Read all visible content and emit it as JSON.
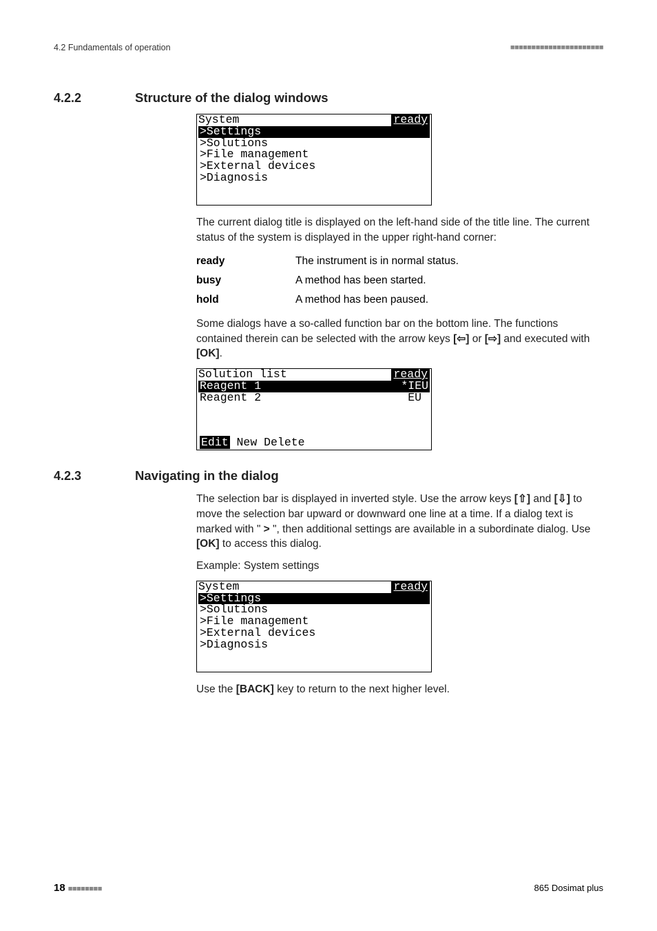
{
  "header": {
    "left": "4.2 Fundamentals of operation",
    "right": "■■■■■■■■■■■■■■■■■■■■■■"
  },
  "sec422": {
    "num": "4.2.2",
    "title": "Structure of the dialog windows",
    "lcd1": {
      "title_left": "System",
      "title_right": "ready",
      "rows": [
        {
          "text": ">Settings",
          "sel": true
        },
        {
          "text": ">Solutions",
          "sel": false
        },
        {
          "text": ">File management",
          "sel": false
        },
        {
          "text": ">External devices",
          "sel": false
        },
        {
          "text": ">Diagnosis",
          "sel": false
        }
      ]
    },
    "para1": "The current dialog title is displayed on the left-hand side of the title line. The current status of the system is displayed in the upper right-hand corner:",
    "defs": [
      {
        "term": "ready",
        "desc": "The instrument is in normal status."
      },
      {
        "term": "busy",
        "desc": "A method has been started."
      },
      {
        "term": "hold",
        "desc": "A method has been paused."
      }
    ],
    "para2_a": "Some dialogs have a so-called function bar on the bottom line. The functions contained therein can be selected with the arrow keys ",
    "para2_b": " or ",
    "para2_c": " and executed with ",
    "key_left": "[⇦]",
    "key_right": "[⇨]",
    "key_ok": "[OK]",
    "para2_d": ".",
    "lcd2": {
      "title_left": "Solution list",
      "title_right": "ready",
      "rows": [
        {
          "left": "Reagent 1",
          "right": "*IEU",
          "sel": true
        },
        {
          "left": "Reagent 2",
          "right": "EU",
          "sel": false
        }
      ],
      "func": {
        "sel": "Edit",
        "rest": " New Delete"
      }
    }
  },
  "sec423": {
    "num": "4.2.3",
    "title": "Navigating in the dialog",
    "para1_a": "The selection bar is displayed in inverted style. Use the arrow keys ",
    "key_up": "[⇧]",
    "para1_b": " and ",
    "key_down": "[⇩]",
    "para1_c": " to move the selection bar upward or downward one line at a time. If a dialog text is marked with \" ",
    "gt": ">",
    "para1_d": " \", then additional settings are available in a subordinate dialog. Use ",
    "key_ok": "[OK]",
    "para1_e": " to access this dialog.",
    "example": "Example: System settings",
    "lcd3": {
      "title_left": "System",
      "title_right": "ready",
      "rows": [
        {
          "text": ">Settings",
          "sel": true
        },
        {
          "text": ">Solutions",
          "sel": false
        },
        {
          "text": ">File management",
          "sel": false
        },
        {
          "text": ">External devices",
          "sel": false
        },
        {
          "text": ">Diagnosis",
          "sel": false
        }
      ]
    },
    "para2_a": "Use the ",
    "key_back": "[BACK]",
    "para2_b": " key to return to the next higher level."
  },
  "footer": {
    "page": "18",
    "dashes": "■■■■■■■■",
    "right": "865 Dosimat plus"
  }
}
